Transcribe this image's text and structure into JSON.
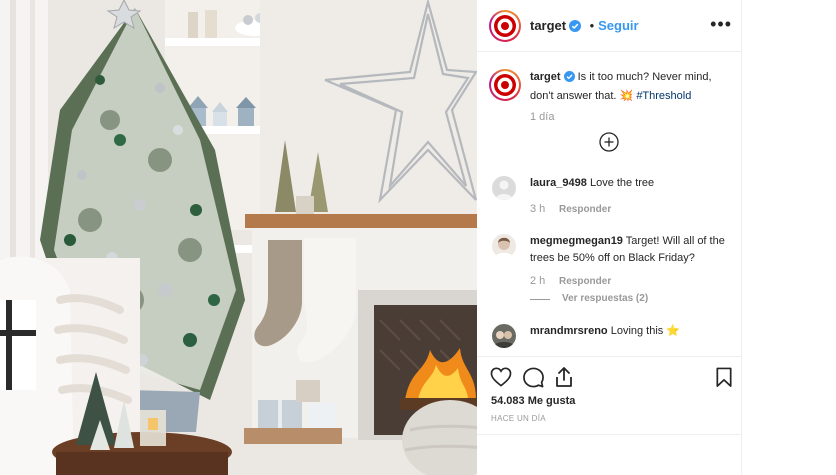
{
  "post": {
    "username": "target",
    "follow_label": "Seguir",
    "more_label": "•••",
    "caption": {
      "username": "target",
      "text": "Is it too much? Never mind, don't answer that. 💥",
      "hashtag": "#Threshold",
      "time": "1 día"
    },
    "comments": [
      {
        "username": "laura_9498",
        "text": "Love the tree",
        "time": "3 h",
        "reply_label": "Responder"
      },
      {
        "username": "megmegmegan19",
        "text": "Target! Will all of the trees be 50% off on Black Friday?",
        "time": "2 h",
        "reply_label": "Responder",
        "view_replies_label": "Ver respuestas (2)"
      },
      {
        "username": "mrandmrsreno",
        "text": "Loving this ⭐"
      }
    ],
    "likes": "54.083 Me gusta",
    "posted_ago": "HACE UN DÍA"
  },
  "icons": {
    "like": "heart-icon",
    "comment": "comment-icon",
    "share": "share-icon",
    "save": "bookmark-icon",
    "load_more": "plus-circle-icon",
    "verified": "verified-badge-icon"
  },
  "colors": {
    "brand_red": "#cc0000",
    "link_blue": "#3897f0",
    "hashtag_blue": "#003569",
    "muted_gray": "#999999",
    "divider": "#efefef"
  }
}
